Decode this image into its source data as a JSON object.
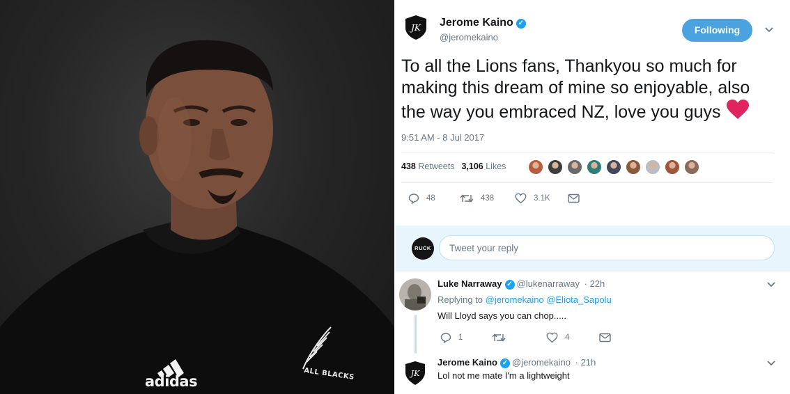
{
  "photo": {
    "jersey_brand_text": "adidas",
    "jersey_badge_text": "ALL BLACKS"
  },
  "tweet": {
    "author_name": "Jerome Kaino",
    "author_handle": "@jeromekaino",
    "follow_label": "Following",
    "text": "To all the Lions fans, Thankyou so much for making this dream of mine so enjoyable, also the way you embraced NZ, love you guys",
    "emoji": "red-heart",
    "timestamp": "9:51 AM - 8 Jul 2017",
    "retweets_count": "438",
    "retweets_label": "Retweets",
    "likes_count": "3,106",
    "likes_label": "Likes",
    "liker_colors": [
      "#b85c3c",
      "#3d3d3d",
      "#6a6a6a",
      "#2f7f78",
      "#404a5c",
      "#8a5a3a",
      "#b9bec4",
      "#a0563a",
      "#8c6a5a"
    ],
    "actions": {
      "reply_count": "48",
      "retweet_count": "438",
      "like_count": "3.1K"
    }
  },
  "reply_box": {
    "avatar_text": "RUCK",
    "placeholder": "Tweet your reply"
  },
  "replies": [
    {
      "name": "Luke Narraway",
      "handle": "@lukenarraway",
      "time": "· 22h",
      "replying_prefix": "Replying to",
      "replying_to_1": "@jeromekaino",
      "replying_to_2": "@Eliota_Sapolu",
      "text": "Will Lloyd says you can chop.....",
      "reply_count": "1",
      "like_count": "4"
    },
    {
      "name": "Jerome Kaino",
      "handle": "@jeromekaino",
      "time": "· 21h",
      "text": "Lol not me mate I'm a lightweight"
    }
  ],
  "colors": {
    "accent_blue": "#1da1f2",
    "follow_button": "#4aa3df",
    "reply_area_bg": "#e8f5fd",
    "heart": "#e0245e"
  }
}
